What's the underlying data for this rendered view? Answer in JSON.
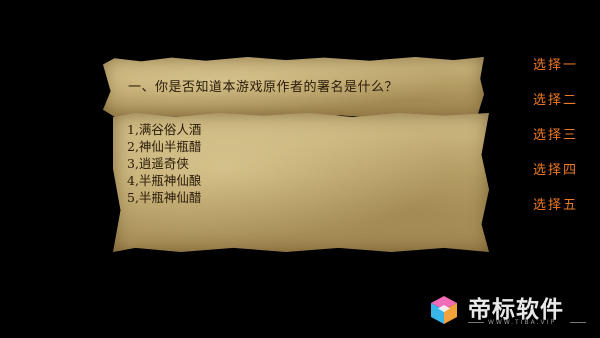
{
  "question": {
    "text": "一、你是否知道本游戏原作者的署名是什么？"
  },
  "answers": [
    {
      "label": "1,满谷俗人酒"
    },
    {
      "label": "2,神仙半瓶醋"
    },
    {
      "label": "3,逍遥奇侠"
    },
    {
      "label": "4,半瓶神仙酿"
    },
    {
      "label": "5,半瓶神仙醋"
    }
  ],
  "choices": [
    {
      "label": "选择一"
    },
    {
      "label": "选择二"
    },
    {
      "label": "选择三"
    },
    {
      "label": "选择四"
    },
    {
      "label": "选择五"
    }
  ],
  "watermark": {
    "title": "帝标软件",
    "subtitle": "WWW.TIBA.VIP"
  },
  "colors": {
    "background": "#000000",
    "choice_text": "#ee7a25",
    "parchment": "#bca66c",
    "ink": "#2a1a08"
  }
}
